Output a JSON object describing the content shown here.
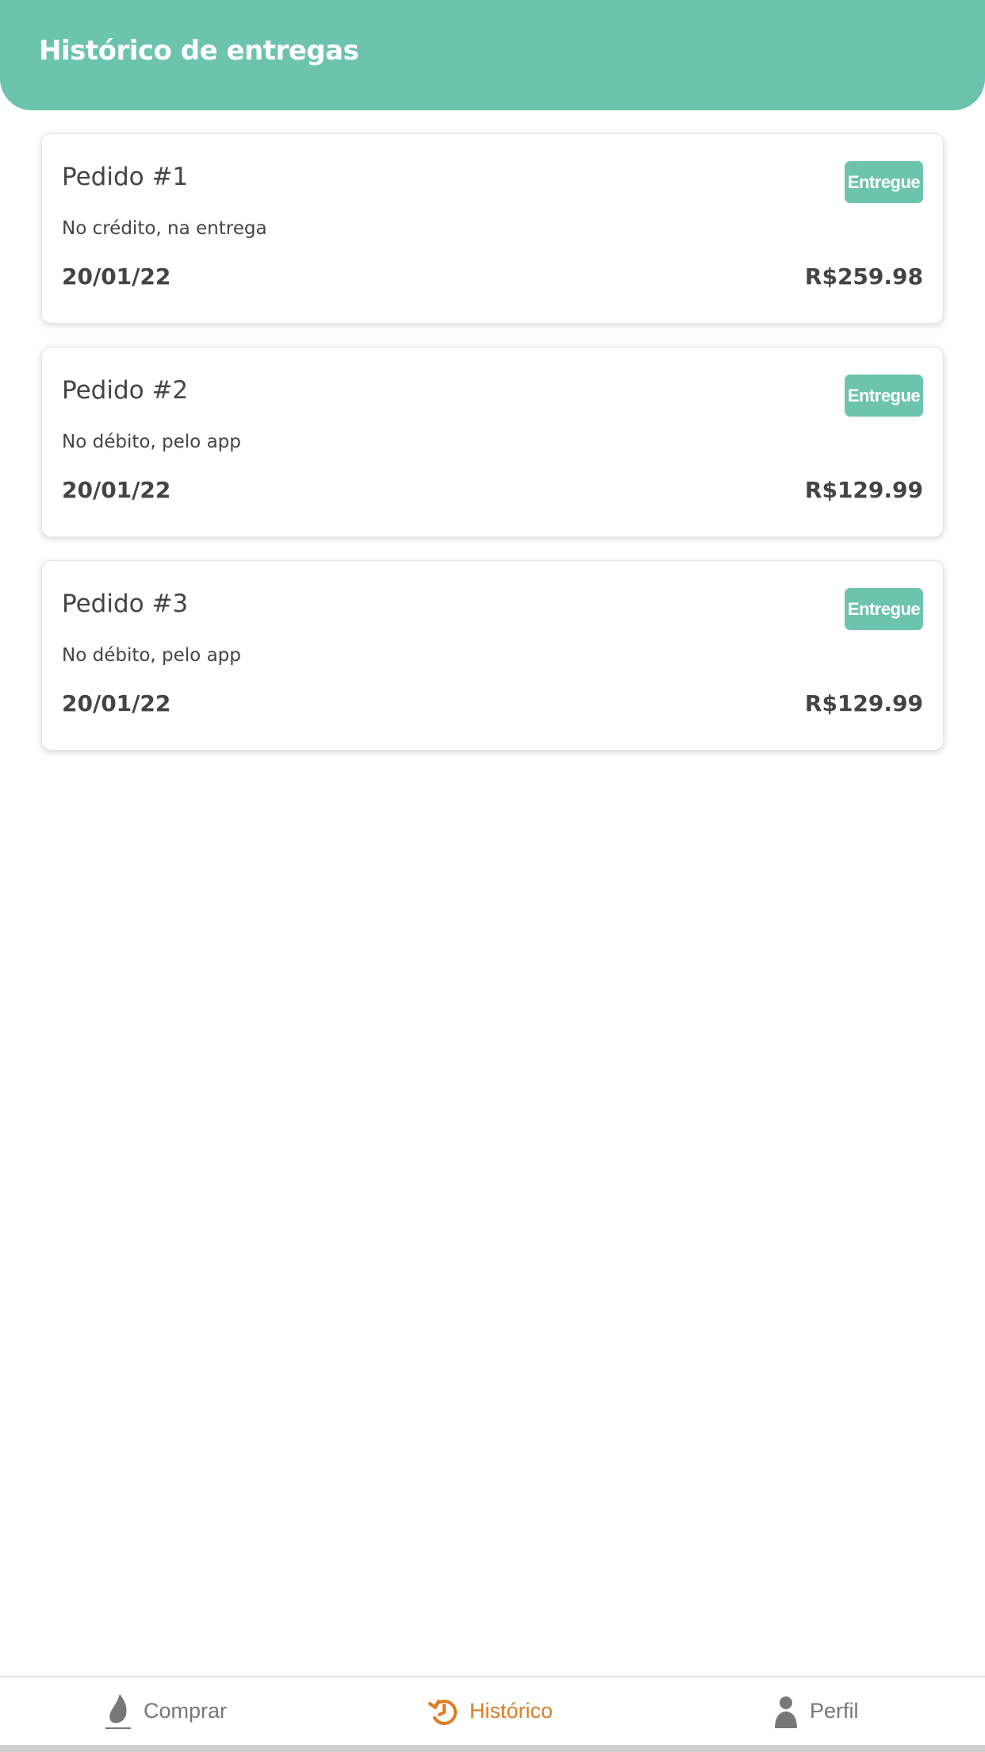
{
  "header": {
    "title": "Histórico de entregas"
  },
  "orders": [
    {
      "title": "Pedido #1",
      "status": "Entregue",
      "payment": "No crédito, na entrega",
      "date": "20/01/22",
      "amount": "R$259.98"
    },
    {
      "title": "Pedido #2",
      "status": "Entregue",
      "payment": "No débito, pelo app",
      "date": "20/01/22",
      "amount": "R$129.99"
    },
    {
      "title": "Pedido #3",
      "status": "Entregue",
      "payment": "No débito, pelo app",
      "date": "20/01/22",
      "amount": "R$129.99"
    }
  ],
  "nav": {
    "items": [
      {
        "label": "Comprar",
        "icon": "flame-icon",
        "active": false
      },
      {
        "label": "Histórico",
        "icon": "history-icon",
        "active": true
      },
      {
        "label": "Perfil",
        "icon": "person-icon",
        "active": false
      }
    ]
  },
  "colors": {
    "accent": "#6cc3ae",
    "active_nav": "#e07b24",
    "text": "#444444",
    "nav_inactive": "#777777"
  }
}
